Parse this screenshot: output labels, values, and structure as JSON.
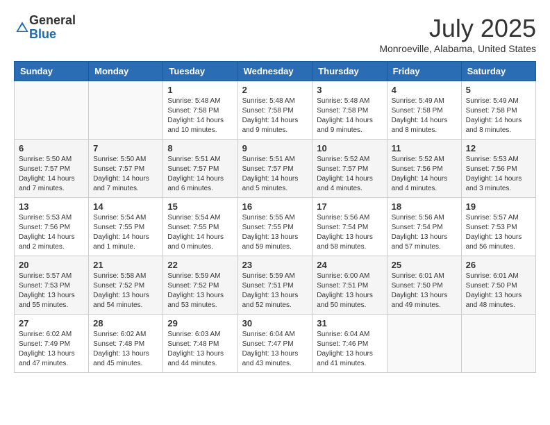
{
  "logo": {
    "general": "General",
    "blue": "Blue"
  },
  "title": "July 2025",
  "location": "Monroeville, Alabama, United States",
  "headers": [
    "Sunday",
    "Monday",
    "Tuesday",
    "Wednesday",
    "Thursday",
    "Friday",
    "Saturday"
  ],
  "weeks": [
    [
      {
        "num": "",
        "info": ""
      },
      {
        "num": "",
        "info": ""
      },
      {
        "num": "1",
        "info": "Sunrise: 5:48 AM\nSunset: 7:58 PM\nDaylight: 14 hours and 10 minutes."
      },
      {
        "num": "2",
        "info": "Sunrise: 5:48 AM\nSunset: 7:58 PM\nDaylight: 14 hours and 9 minutes."
      },
      {
        "num": "3",
        "info": "Sunrise: 5:48 AM\nSunset: 7:58 PM\nDaylight: 14 hours and 9 minutes."
      },
      {
        "num": "4",
        "info": "Sunrise: 5:49 AM\nSunset: 7:58 PM\nDaylight: 14 hours and 8 minutes."
      },
      {
        "num": "5",
        "info": "Sunrise: 5:49 AM\nSunset: 7:58 PM\nDaylight: 14 hours and 8 minutes."
      }
    ],
    [
      {
        "num": "6",
        "info": "Sunrise: 5:50 AM\nSunset: 7:57 PM\nDaylight: 14 hours and 7 minutes."
      },
      {
        "num": "7",
        "info": "Sunrise: 5:50 AM\nSunset: 7:57 PM\nDaylight: 14 hours and 7 minutes."
      },
      {
        "num": "8",
        "info": "Sunrise: 5:51 AM\nSunset: 7:57 PM\nDaylight: 14 hours and 6 minutes."
      },
      {
        "num": "9",
        "info": "Sunrise: 5:51 AM\nSunset: 7:57 PM\nDaylight: 14 hours and 5 minutes."
      },
      {
        "num": "10",
        "info": "Sunrise: 5:52 AM\nSunset: 7:57 PM\nDaylight: 14 hours and 4 minutes."
      },
      {
        "num": "11",
        "info": "Sunrise: 5:52 AM\nSunset: 7:56 PM\nDaylight: 14 hours and 4 minutes."
      },
      {
        "num": "12",
        "info": "Sunrise: 5:53 AM\nSunset: 7:56 PM\nDaylight: 14 hours and 3 minutes."
      }
    ],
    [
      {
        "num": "13",
        "info": "Sunrise: 5:53 AM\nSunset: 7:56 PM\nDaylight: 14 hours and 2 minutes."
      },
      {
        "num": "14",
        "info": "Sunrise: 5:54 AM\nSunset: 7:55 PM\nDaylight: 14 hours and 1 minute."
      },
      {
        "num": "15",
        "info": "Sunrise: 5:54 AM\nSunset: 7:55 PM\nDaylight: 14 hours and 0 minutes."
      },
      {
        "num": "16",
        "info": "Sunrise: 5:55 AM\nSunset: 7:55 PM\nDaylight: 13 hours and 59 minutes."
      },
      {
        "num": "17",
        "info": "Sunrise: 5:56 AM\nSunset: 7:54 PM\nDaylight: 13 hours and 58 minutes."
      },
      {
        "num": "18",
        "info": "Sunrise: 5:56 AM\nSunset: 7:54 PM\nDaylight: 13 hours and 57 minutes."
      },
      {
        "num": "19",
        "info": "Sunrise: 5:57 AM\nSunset: 7:53 PM\nDaylight: 13 hours and 56 minutes."
      }
    ],
    [
      {
        "num": "20",
        "info": "Sunrise: 5:57 AM\nSunset: 7:53 PM\nDaylight: 13 hours and 55 minutes."
      },
      {
        "num": "21",
        "info": "Sunrise: 5:58 AM\nSunset: 7:52 PM\nDaylight: 13 hours and 54 minutes."
      },
      {
        "num": "22",
        "info": "Sunrise: 5:59 AM\nSunset: 7:52 PM\nDaylight: 13 hours and 53 minutes."
      },
      {
        "num": "23",
        "info": "Sunrise: 5:59 AM\nSunset: 7:51 PM\nDaylight: 13 hours and 52 minutes."
      },
      {
        "num": "24",
        "info": "Sunrise: 6:00 AM\nSunset: 7:51 PM\nDaylight: 13 hours and 50 minutes."
      },
      {
        "num": "25",
        "info": "Sunrise: 6:01 AM\nSunset: 7:50 PM\nDaylight: 13 hours and 49 minutes."
      },
      {
        "num": "26",
        "info": "Sunrise: 6:01 AM\nSunset: 7:50 PM\nDaylight: 13 hours and 48 minutes."
      }
    ],
    [
      {
        "num": "27",
        "info": "Sunrise: 6:02 AM\nSunset: 7:49 PM\nDaylight: 13 hours and 47 minutes."
      },
      {
        "num": "28",
        "info": "Sunrise: 6:02 AM\nSunset: 7:48 PM\nDaylight: 13 hours and 45 minutes."
      },
      {
        "num": "29",
        "info": "Sunrise: 6:03 AM\nSunset: 7:48 PM\nDaylight: 13 hours and 44 minutes."
      },
      {
        "num": "30",
        "info": "Sunrise: 6:04 AM\nSunset: 7:47 PM\nDaylight: 13 hours and 43 minutes."
      },
      {
        "num": "31",
        "info": "Sunrise: 6:04 AM\nSunset: 7:46 PM\nDaylight: 13 hours and 41 minutes."
      },
      {
        "num": "",
        "info": ""
      },
      {
        "num": "",
        "info": ""
      }
    ]
  ]
}
